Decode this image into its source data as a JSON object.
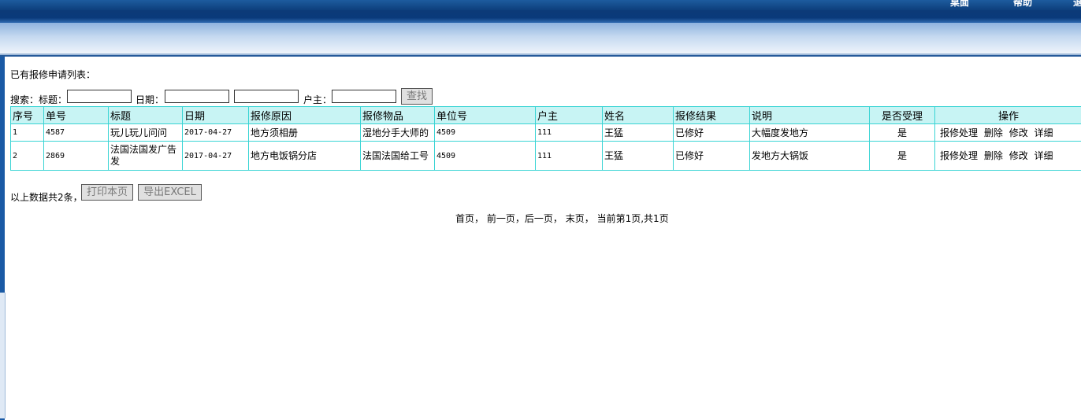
{
  "header": {
    "links": [
      "桌面",
      "帮助",
      "退出"
    ]
  },
  "page": {
    "list_title": "已有报修申请列表：",
    "search": {
      "label": "搜索：",
      "title_label": "标题：",
      "title_value": "",
      "date_label": "日期：",
      "date_from": "",
      "date_to": "",
      "owner_label": "户主：",
      "owner_value": "",
      "button": "查找"
    },
    "table": {
      "columns": [
        "序号",
        "单号",
        "标题",
        "日期",
        "报修原因",
        "报修物品",
        "单位号",
        "户主",
        "姓名",
        "报修结果",
        "说明",
        "是否受理",
        "操作"
      ],
      "rows": [
        {
          "seq": "1",
          "no": "4587",
          "title": "玩儿玩儿问问",
          "date": "2017-04-27",
          "reason": "地方须相册",
          "item": "湿地分手大师的",
          "unit": "4509",
          "owner": "111",
          "name": "王猛",
          "result": "已修好",
          "note": "大幅度发地方",
          "accepted": "是"
        },
        {
          "seq": "2",
          "no": "2869",
          "title": "法国法国发广告发",
          "date": "2017-04-27",
          "reason": "地方电饭锅分店",
          "item": "法国法国给工号",
          "unit": "4509",
          "owner": "111",
          "name": "王猛",
          "result": "已修好",
          "note": "发地方大锅饭",
          "accepted": "是"
        }
      ],
      "actions": [
        "报修处理",
        "删除",
        "修改",
        "详细"
      ]
    },
    "summary": "以上数据共2条，",
    "print_button": "打印本页",
    "export_button": "导出EXCEL",
    "pager": {
      "first": "首页",
      "prev": "前一页",
      "next": "后一页",
      "last": "末页",
      "status": "当前第1页,共1页"
    }
  },
  "colors": {
    "header_blue": "#0d3f7c",
    "table_border": "#39d4d4",
    "table_header_bg": "#c8f4f4"
  }
}
